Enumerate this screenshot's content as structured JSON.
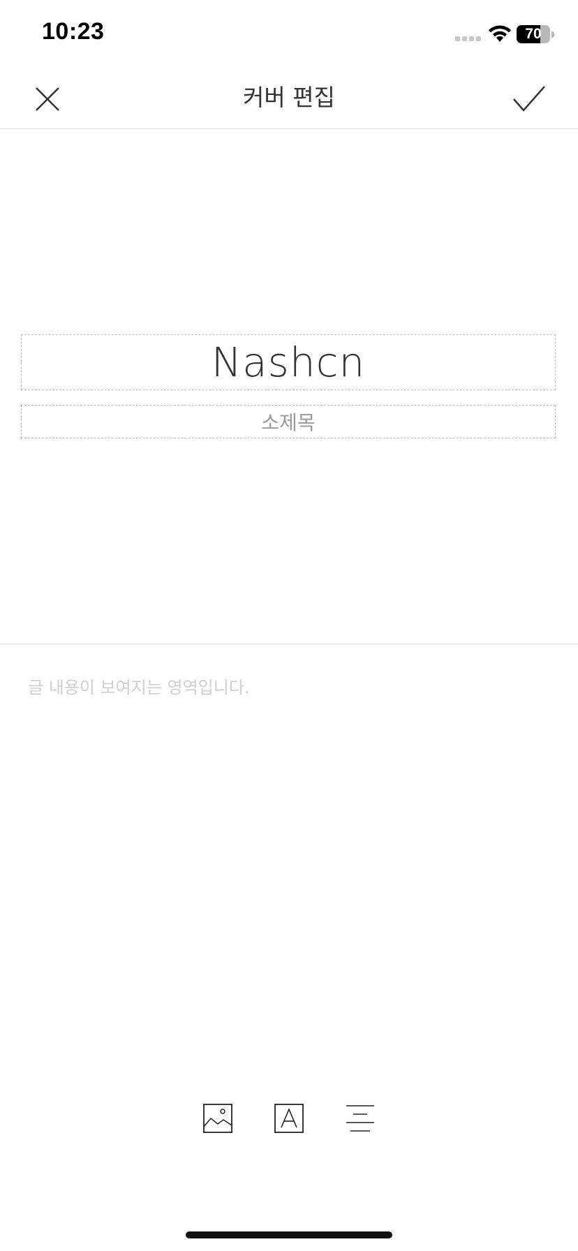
{
  "status_bar": {
    "time": "10:23",
    "battery_level": "70",
    "battery_fraction": 0.7
  },
  "nav": {
    "title": "커버 편집"
  },
  "cover": {
    "title": "Nashcn",
    "subtitle_placeholder": "소제목"
  },
  "body": {
    "placeholder": "글 내용이 보여지는 영역입니다."
  },
  "toolbar": {
    "items": [
      "image-icon",
      "text-style-icon",
      "align-center-icon"
    ]
  },
  "colors": {
    "accent": "#333333",
    "placeholder": "#cfcfcf",
    "divider": "#dcdcdc"
  }
}
